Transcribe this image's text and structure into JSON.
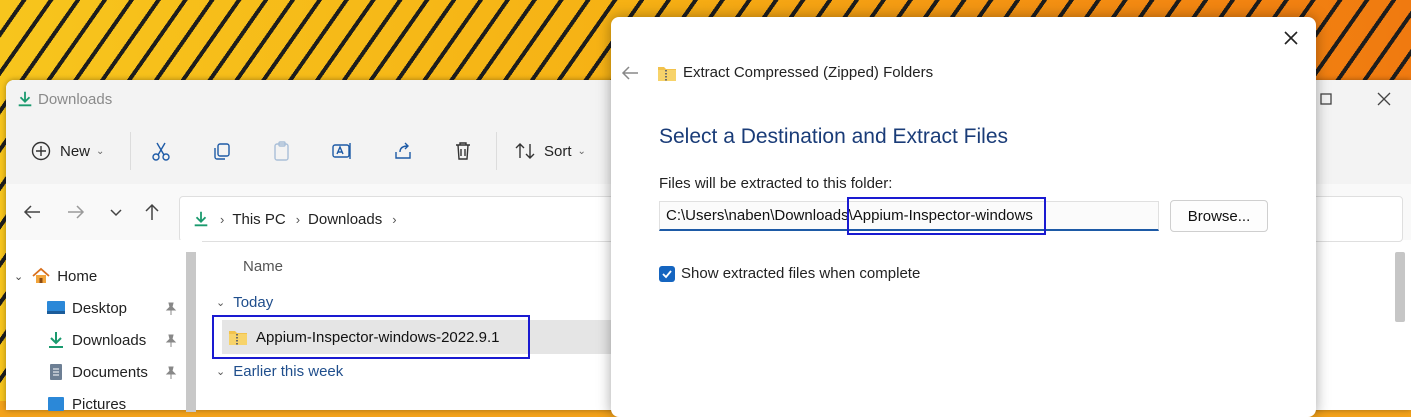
{
  "explorer": {
    "title": "Downloads",
    "toolbar": {
      "new_label": "New",
      "sort_label": "Sort"
    },
    "address": {
      "segments": [
        "This PC",
        "Downloads"
      ]
    },
    "sidebar": {
      "items": [
        {
          "label": "Home"
        },
        {
          "label": "Desktop"
        },
        {
          "label": "Downloads"
        },
        {
          "label": "Documents"
        },
        {
          "label": "Pictures"
        }
      ]
    },
    "list": {
      "column_name": "Name",
      "groups": [
        "Today",
        "Earlier this week"
      ],
      "selected_item": "Appium-Inspector-windows-2022.9.1"
    }
  },
  "dialog": {
    "title": "Extract Compressed (Zipped) Folders",
    "heading": "Select a Destination and Extract Files",
    "folder_label": "Files will be extracted to this folder:",
    "folder_value": "C:\\Users\\naben\\Downloads\\Appium-Inspector-windows",
    "browse_label": "Browse...",
    "show_files_label": "Show extracted files when complete",
    "show_files_checked": true
  },
  "colors": {
    "accent": "#1565c0",
    "heading": "#1a3c78",
    "highlight_box": "#1a1ad1"
  }
}
